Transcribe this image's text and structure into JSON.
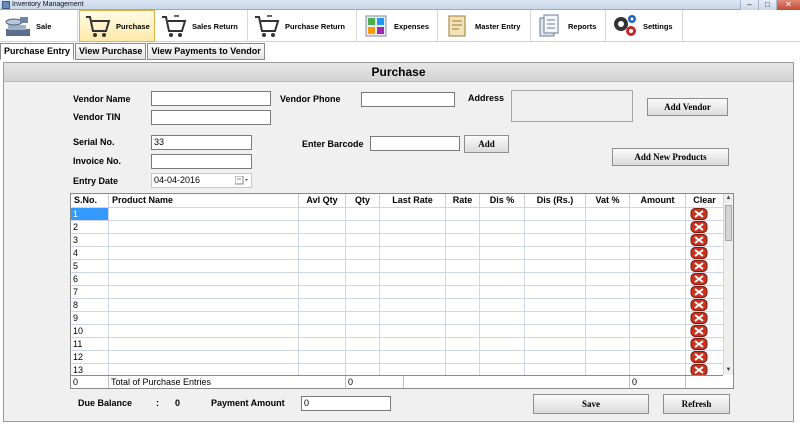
{
  "window": {
    "title": "Inventory Management",
    "min_glyph": "–",
    "max_glyph": "□",
    "close_glyph": "✕"
  },
  "toolbar": [
    {
      "label": "Sale",
      "icon": "scale-icon"
    },
    {
      "label": "Purchase",
      "icon": "cart-icon"
    },
    {
      "label": "Sales Return",
      "icon": "cart-return-icon"
    },
    {
      "label": "Purchase Return",
      "icon": "cart-return-icon"
    },
    {
      "label": "Expenses",
      "icon": "expenses-icon"
    },
    {
      "label": "Master Entry",
      "icon": "master-entry-icon"
    },
    {
      "label": "Reports",
      "icon": "reports-icon"
    },
    {
      "label": "Settings",
      "icon": "gears-icon"
    }
  ],
  "active_tool": "Purchase",
  "subtabs": [
    "Purchase Entry",
    "View Purchase",
    "View Payments to Vendor"
  ],
  "panel": {
    "title": "Purchase"
  },
  "form": {
    "vendor_name_label": "Vendor Name",
    "vendor_name_value": "",
    "vendor_tin_label": "Vendor TIN",
    "vendor_tin_value": "",
    "vendor_phone_label": "Vendor Phone",
    "vendor_phone_value": "",
    "address_label": "Address",
    "address_value": "",
    "add_vendor_label": "Add Vendor",
    "serial_label": "Serial No.",
    "serial_value": "33",
    "invoice_label": "Invoice No.",
    "invoice_value": "",
    "entry_date_label": "Entry Date",
    "entry_date_value": "04-04-2016",
    "barcode_label": "Enter Barcode",
    "barcode_value": "",
    "add_label": "Add",
    "add_new_products_label": "Add New Products"
  },
  "grid": {
    "columns": [
      "S.No.",
      "Product Name",
      "Avl Qty",
      "Qty",
      "Last Rate",
      "Rate",
      "Dis %",
      "Dis (Rs.)",
      "Vat %",
      "Amount",
      "Clear"
    ],
    "rows": [
      "1",
      "2",
      "3",
      "4",
      "5",
      "6",
      "7",
      "8",
      "9",
      "10",
      "11",
      "12",
      "13"
    ],
    "selected_row": "1",
    "footer": {
      "count": "0",
      "label": "Total of Purchase Entries",
      "qty_total": "0",
      "amount_total": "0"
    }
  },
  "bottom": {
    "due_balance_label": "Due Balance",
    "due_balance_sep": ":",
    "due_balance_value": "0",
    "payment_amount_label": "Payment Amount",
    "payment_amount_value": "0",
    "save_label": "Save",
    "refresh_label": "Refresh"
  },
  "colors": {
    "selection": "#3399ff",
    "clear_icon": "#c8321e",
    "active_tool": "#fde9a8"
  }
}
